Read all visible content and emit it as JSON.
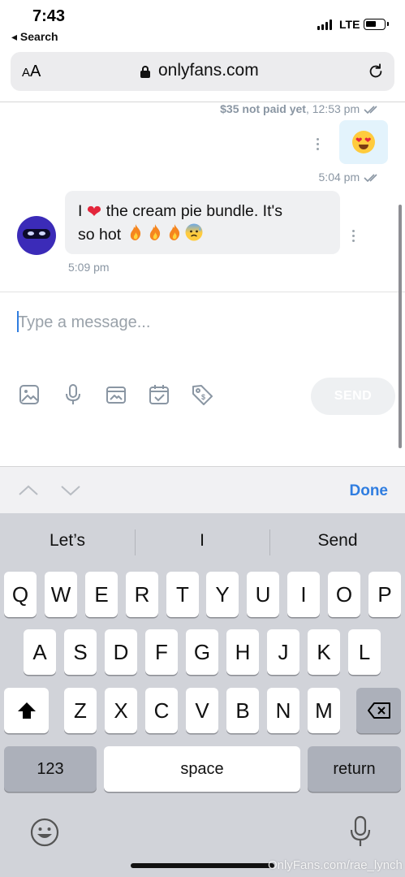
{
  "status_bar": {
    "time": "7:43",
    "back_label": "◂ Search",
    "network": "LTE"
  },
  "browser": {
    "text_size_label_small": "A",
    "text_size_label_large": "A",
    "domain": "onlyfans.com"
  },
  "chat": {
    "unpaid_amount": "$35 not paid yet",
    "unpaid_time": ", 12:53 pm",
    "sent_time": "5:04 pm",
    "incoming_text": "I ❤️ the cream pie bundle. It's so hot 🔥🔥🔥😰",
    "incoming_text_part1": "I",
    "incoming_text_part2": "the cream pie bundle. It's",
    "incoming_text_part3": "so hot",
    "incoming_time": "5:09 pm"
  },
  "composer": {
    "placeholder": "Type a message...",
    "send_label": "SEND"
  },
  "accessory": {
    "done_label": "Done"
  },
  "keyboard": {
    "suggestions": [
      "Let’s",
      "I",
      "Send"
    ],
    "row1": [
      "Q",
      "W",
      "E",
      "R",
      "T",
      "Y",
      "U",
      "I",
      "O",
      "P"
    ],
    "row2": [
      "A",
      "S",
      "D",
      "F",
      "G",
      "H",
      "J",
      "K",
      "L"
    ],
    "row3": [
      "Z",
      "X",
      "C",
      "V",
      "B",
      "N",
      "M"
    ],
    "numbers_label": "123",
    "space_label": "space",
    "return_label": "return"
  },
  "watermark": "OnlyFans.com/rae_lynch",
  "colors": {
    "accent": "#2f7de0",
    "muted_text": "#8a96a3",
    "sent_bubble": "#e3f3fc",
    "received_bubble": "#eff0f2",
    "keyboard_bg": "#d1d3d9"
  }
}
